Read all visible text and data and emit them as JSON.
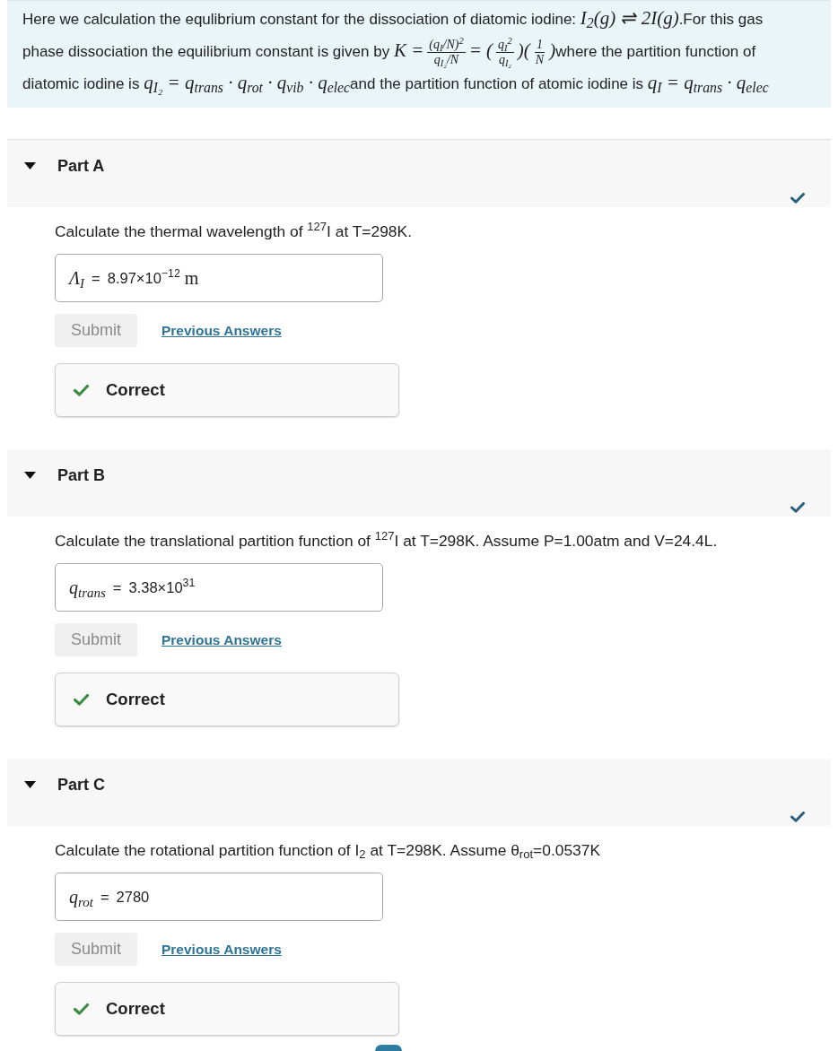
{
  "intro": {
    "segments": [
      {
        "kind": "text",
        "text": "Here we calculation the equlibrium constant for the dissociation of diatomic iodine: "
      },
      {
        "kind": "math",
        "text": "I$_{2}$(g) ⇌ 2I(g)"
      },
      {
        "kind": "text",
        "text": ".For this gas phase dissociation the equilibrium constant is given by "
      },
      {
        "kind": "math",
        "text": "K ="
      },
      {
        "kind": "fraction",
        "numerator": "(q$_{I}$/N)$^{2}$",
        "denominator": "q$_{I₂}$/N"
      },
      {
        "kind": "math",
        "text": "= ("
      },
      {
        "kind": "fraction",
        "numerator": "q$_{I}$$^{2}$",
        "denominator": "q$_{I₂}$"
      },
      {
        "kind": "math",
        "text": ")("
      },
      {
        "kind": "fraction",
        "numerator": "1",
        "denominator": "N"
      },
      {
        "kind": "math",
        "text": ")"
      },
      {
        "kind": "text",
        "text": "where the partition function of diatomic iodine is "
      },
      {
        "kind": "math",
        "text": "q$_{I₂}$ = q$_{trans}$ · q$_{rot}$ · q$_{vib}$ · q$_{elec}$"
      },
      {
        "kind": "text",
        "text": "and the partition function of atomic iodine is "
      },
      {
        "kind": "math",
        "text": "q$_{I}$ = q$_{trans}$ · q$_{elec}$"
      }
    ]
  },
  "parts": [
    {
      "title": "Part A",
      "expanded": true,
      "completed": true,
      "question": "Calculate the thermal wavelength of $^{127}$I at T=298K.",
      "answer": {
        "label": "Λ$_{I}$",
        "equals": "=",
        "value": "8.97×10$^{−12}$",
        "unit": "m"
      },
      "submit": {
        "label": "Submit",
        "disabled": true
      },
      "link": "Previous Answers",
      "feedback": {
        "kind": "correct",
        "text": "Correct"
      }
    },
    {
      "title": "Part B",
      "expanded": true,
      "completed": true,
      "question": "Calculate the translational partition function of $^{127}$I at T=298K. Assume P=1.00atm and V=24.4L.",
      "answer": {
        "label": "q$_{trans}$",
        "equals": "=",
        "value": "3.38×10$^{31}$"
      },
      "submit": {
        "label": "Submit",
        "disabled": true
      },
      "link": "Previous Answers",
      "feedback": {
        "kind": "correct",
        "text": "Correct"
      }
    },
    {
      "title": "Part C",
      "expanded": true,
      "completed": true,
      "question": "Calculate the rotational partition function of I$_{2}$ at T=298K. Assume θ$_{rot}$=0.0537K",
      "answer": {
        "label": "q$_{rot}$",
        "equals": "=",
        "value": "2780"
      },
      "submit": {
        "label": "Submit",
        "disabled": true
      },
      "link": "Previous Answers",
      "feedback": {
        "kind": "correct",
        "text": "Correct"
      }
    }
  ]
}
